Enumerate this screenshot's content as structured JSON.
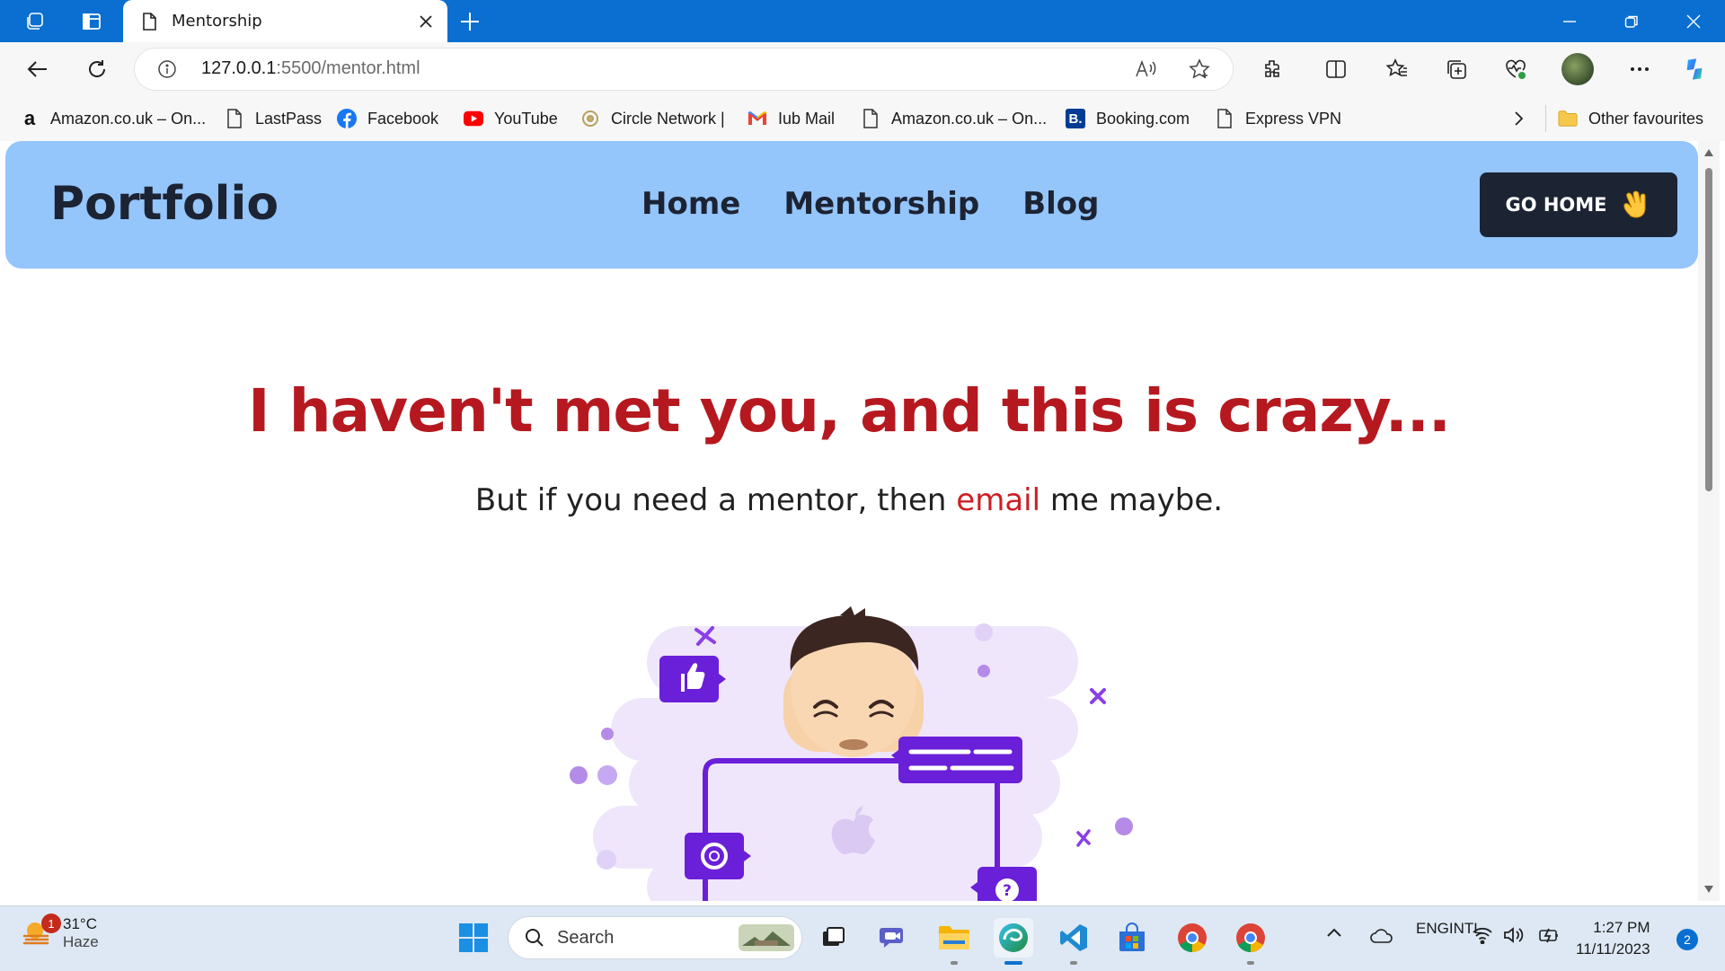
{
  "browser": {
    "tab_title": "Mentorship",
    "url_host": "127.0.0.1",
    "url_path": ":5500/mentor.html"
  },
  "favourites": {
    "items": [
      {
        "label": "Amazon.co.uk – On...",
        "icon": "amazon-icon"
      },
      {
        "label": "LastPass",
        "icon": "page-icon"
      },
      {
        "label": "Facebook",
        "icon": "facebook-icon"
      },
      {
        "label": "YouTube",
        "icon": "youtube-icon"
      },
      {
        "label": "Circle Network |",
        "icon": "circle-network-icon"
      },
      {
        "label": "Iub Mail",
        "icon": "gmail-icon"
      },
      {
        "label": "Amazon.co.uk – On...",
        "icon": "page-icon"
      },
      {
        "label": "Booking.com",
        "icon": "booking-icon"
      },
      {
        "label": "Express VPN",
        "icon": "page-icon"
      }
    ],
    "other_label": "Other favourites"
  },
  "site": {
    "logo": "Portfolio",
    "nav": [
      "Home",
      "Mentorship",
      "Blog"
    ],
    "cta_label": "GO HOME",
    "headline": "I haven't met you, and this is crazy...",
    "subline_before": "But if you need a mentor, then ",
    "subline_link": "email",
    "subline_after": " me maybe.",
    "colors": {
      "header_bg": "#94c5fb",
      "headline": "#b5191f",
      "button_bg": "#1c2333",
      "illustration_purple": "#6a1fd8"
    }
  },
  "taskbar": {
    "weather_temp": "31°C",
    "weather_cond": "Haze",
    "weather_badge": "1",
    "search_placeholder": "Search",
    "lang_top": "ENG",
    "lang_bottom": "INTL",
    "time": "1:27 PM",
    "date": "11/11/2023",
    "notification_count": "2"
  }
}
